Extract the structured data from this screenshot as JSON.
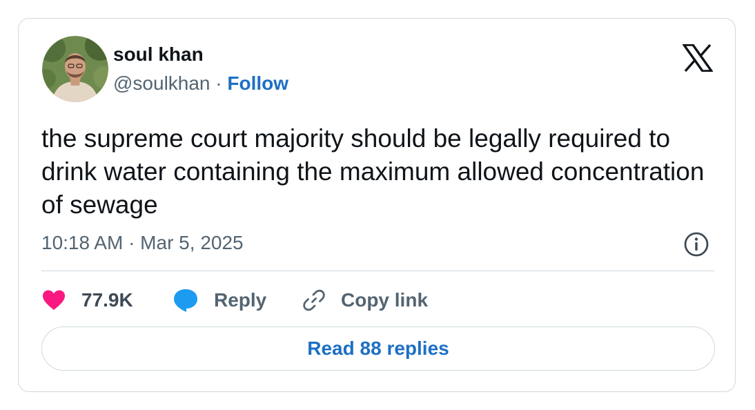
{
  "author": {
    "display_name": "soul khan",
    "handle": "@soulkhan",
    "separator": "·",
    "follow_label": "Follow",
    "avatar_icon": "profile-photo-icon"
  },
  "brand": {
    "logo_icon": "x-logo-icon"
  },
  "tweet": {
    "text": "the supreme court majority should be legally required to drink water containing the maximum allowed concentration of sewage",
    "timestamp": "10:18 AM · Mar 5, 2025"
  },
  "actions": {
    "like_count": "77.9K",
    "reply_label": "Reply",
    "copy_link_label": "Copy link"
  },
  "footer": {
    "read_replies_label": "Read 88 replies"
  },
  "colors": {
    "link_blue": "#1d6fc4",
    "heart_pink": "#f91880",
    "reply_blue": "#1d9bf0",
    "secondary_text": "#536471",
    "border": "#cfd9de"
  }
}
